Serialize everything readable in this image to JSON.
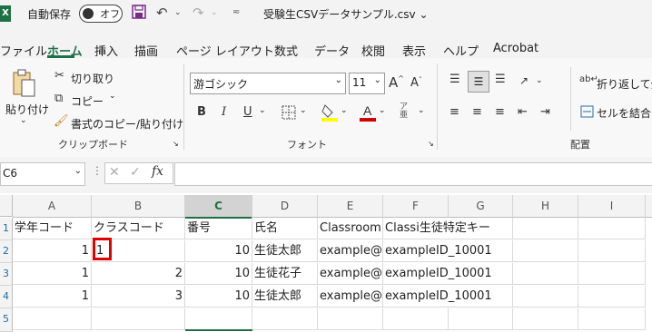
{
  "titlebar": {
    "app_logo": "X",
    "autosave_label": "自動保存",
    "autosave_state": "オフ",
    "filename": "受験生CSVデータサンプル.csv"
  },
  "tabs": [
    "ファイル",
    "ホーム",
    "挿入",
    "描画",
    "ページ レイアウト",
    "数式",
    "データ",
    "校閲",
    "表示",
    "ヘルプ",
    "Acrobat"
  ],
  "active_tab": "ホーム",
  "ribbon": {
    "clipboard": {
      "paste": "貼り付け",
      "cut": "切り取り",
      "copy": "コピー",
      "format_painter": "書式のコピー/貼り付け",
      "label": "クリップボード"
    },
    "font": {
      "name": "游ゴシック",
      "size": "11",
      "bold": "B",
      "italic": "I",
      "underline": "U",
      "label": "フォント"
    },
    "alignment": {
      "wrap_text": "折り返して全",
      "merge": "セルを結合し",
      "label": "配置"
    }
  },
  "formula_bar": {
    "name_box": "C6",
    "fx": "fx",
    "value": ""
  },
  "sheet": {
    "columns": [
      "A",
      "B",
      "C",
      "D",
      "E",
      "F",
      "G",
      "H",
      "I"
    ],
    "selected_column": "C",
    "row_numbers": [
      "1",
      "2",
      "3",
      "4",
      "5"
    ],
    "rows": [
      [
        "学年コード",
        "クラスコード",
        "番号",
        "氏名",
        "Classroom",
        "Classi生徒特定キー",
        "",
        "",
        ""
      ],
      [
        "1",
        "1",
        "10",
        "生徒太郎",
        "example@",
        "exampleID_10001",
        "",
        "",
        ""
      ],
      [
        "1",
        "2",
        "10",
        "生徒花子",
        "example@",
        "exampleID_10001",
        "",
        "",
        ""
      ],
      [
        "1",
        "3",
        "10",
        "生徒太郎",
        "example@",
        "exampleID_10001",
        "",
        "",
        ""
      ],
      [
        "",
        "",
        "",
        "",
        "",
        "",
        "",
        "",
        ""
      ]
    ]
  },
  "colors": {
    "excel_green": "#1e7145",
    "highlight_red": "#e00000",
    "font_color_red": "#d00000",
    "fill_yellow": "#ffff00"
  }
}
